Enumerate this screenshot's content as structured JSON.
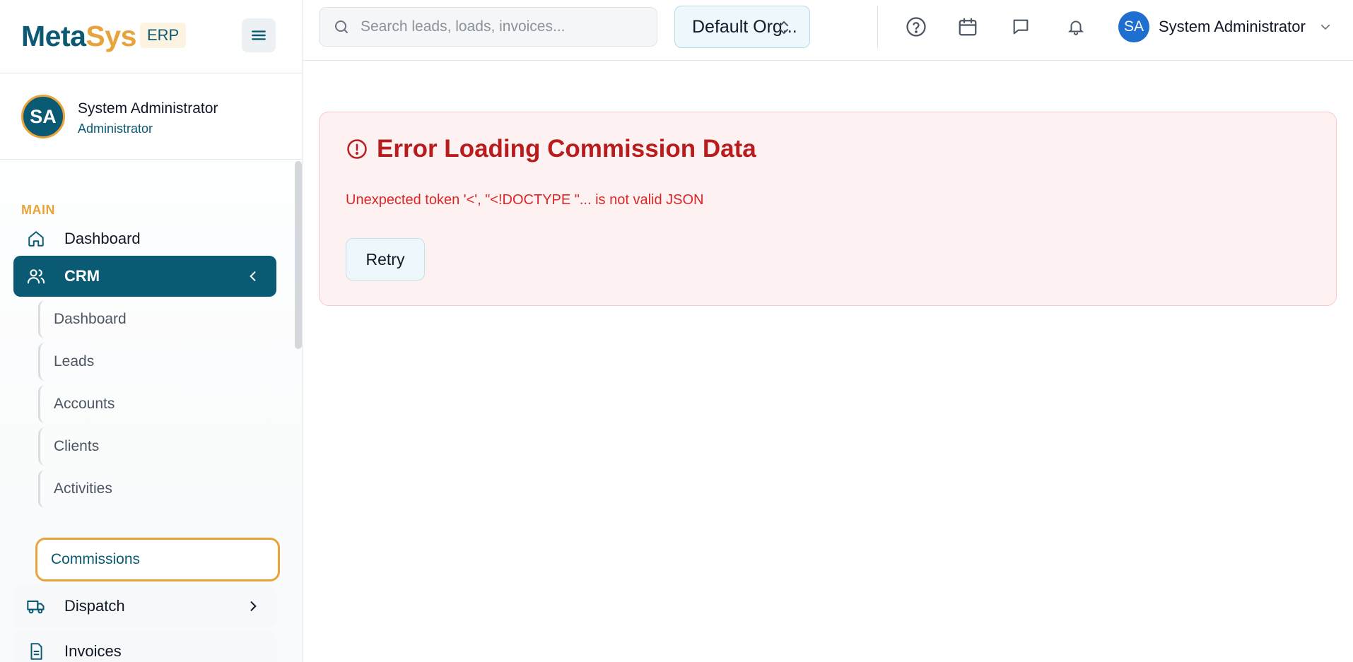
{
  "brand": {
    "name_part1": "Meta",
    "name_part2": "Sys",
    "badge": "ERP"
  },
  "user_card": {
    "initials": "SA",
    "name": "System Administrator",
    "role": "Administrator"
  },
  "sidebar": {
    "section_label": "MAIN",
    "items": [
      {
        "label": "Dashboard",
        "icon": "home-icon"
      },
      {
        "label": "CRM",
        "icon": "users-icon",
        "active": true,
        "expanded": true
      },
      {
        "label": "Dispatch",
        "icon": "truck-icon"
      },
      {
        "label": "Invoices",
        "icon": "invoice-icon"
      }
    ],
    "crm_subitems": [
      {
        "label": "Dashboard"
      },
      {
        "label": "Leads"
      },
      {
        "label": "Accounts"
      },
      {
        "label": "Clients"
      },
      {
        "label": "Activities"
      },
      {
        "label": "Commissions",
        "current": true
      }
    ]
  },
  "topbar": {
    "search_placeholder": "Search leads, loads, invoices...",
    "org_selector": "Default Org...",
    "user_initials": "SA",
    "user_name": "System Administrator"
  },
  "error": {
    "title": "Error Loading Commission Data",
    "message": "Unexpected token '<', \"<!DOCTYPE \"... is not valid JSON",
    "retry_label": "Retry"
  },
  "colors": {
    "brand_primary": "#0b5a74",
    "brand_accent": "#e8a33a",
    "error_text": "#b91c1c",
    "error_bg": "#fef1f1"
  }
}
